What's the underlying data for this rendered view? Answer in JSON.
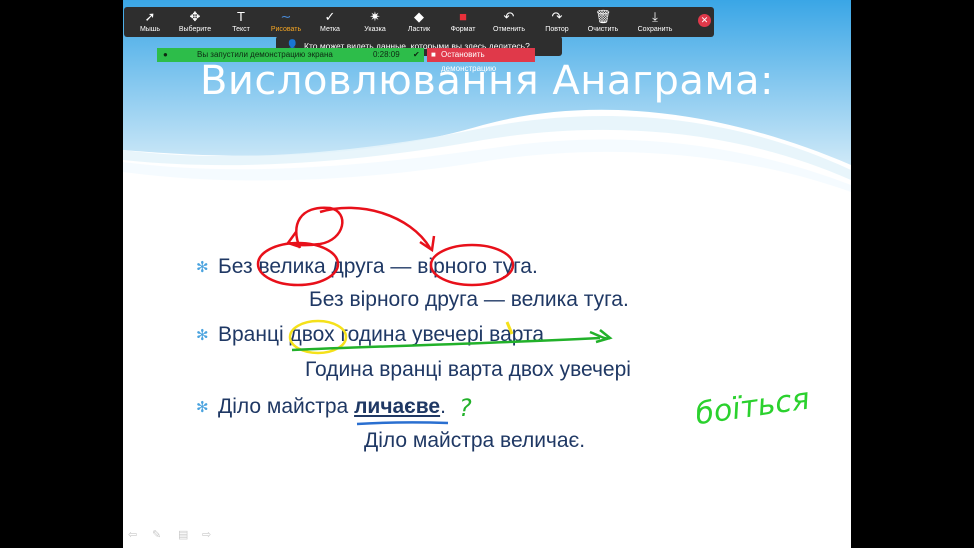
{
  "toolbar": {
    "tools": [
      {
        "label": "Мышь",
        "icon": "mouse-pointer-icon",
        "glyph": "➚"
      },
      {
        "label": "Выберите",
        "icon": "move-icon",
        "glyph": "✥"
      },
      {
        "label": "Текст",
        "icon": "text-icon",
        "glyph": "T"
      },
      {
        "label": "Рисовать",
        "icon": "draw-icon",
        "glyph": "∼"
      },
      {
        "label": "Метка",
        "icon": "stamp-icon",
        "glyph": "✓"
      },
      {
        "label": "Указка",
        "icon": "spotlight-icon",
        "glyph": "✷"
      },
      {
        "label": "Ластик",
        "icon": "eraser-icon",
        "glyph": "◆"
      },
      {
        "label": "Формат",
        "icon": "format-icon",
        "glyph": "■"
      },
      {
        "label": "Отменить",
        "icon": "undo-icon",
        "glyph": "↶"
      },
      {
        "label": "Повтор",
        "icon": "redo-icon",
        "glyph": "↷"
      },
      {
        "label": "Очистить",
        "icon": "trash-icon",
        "glyph": "🗑"
      },
      {
        "label": "Сохранить",
        "icon": "save-icon",
        "glyph": "⤓"
      }
    ],
    "active_tool": "Рисовать",
    "format_color": "#e8303a"
  },
  "tooltip": {
    "text": "Кто может видеть данные, которыми вы здесь делитесь?"
  },
  "share_bar": {
    "status": "Вы запустили демонстрацию экрана",
    "timer": "0:28:09",
    "stop_label": "Остановить демонстрацию"
  },
  "slide": {
    "title": "Висловлювання Анаграма:",
    "bullet1": "Без велика друга — вірного туга.",
    "sub1": "Без вірного друга — велика туга.",
    "bullet2": "Вранці двох година увечері варта",
    "sub2": "Година вранці варта двох увечері",
    "bullet3_prefix": "Діло майстра ",
    "bullet3_bold": "личаєве",
    "bullet3_suffix": ".",
    "sub3": "Діло майстра величає.",
    "bullet_glyph": "✻"
  },
  "annotations": {
    "question_mark": "?",
    "handwritten_word": "боїться"
  }
}
